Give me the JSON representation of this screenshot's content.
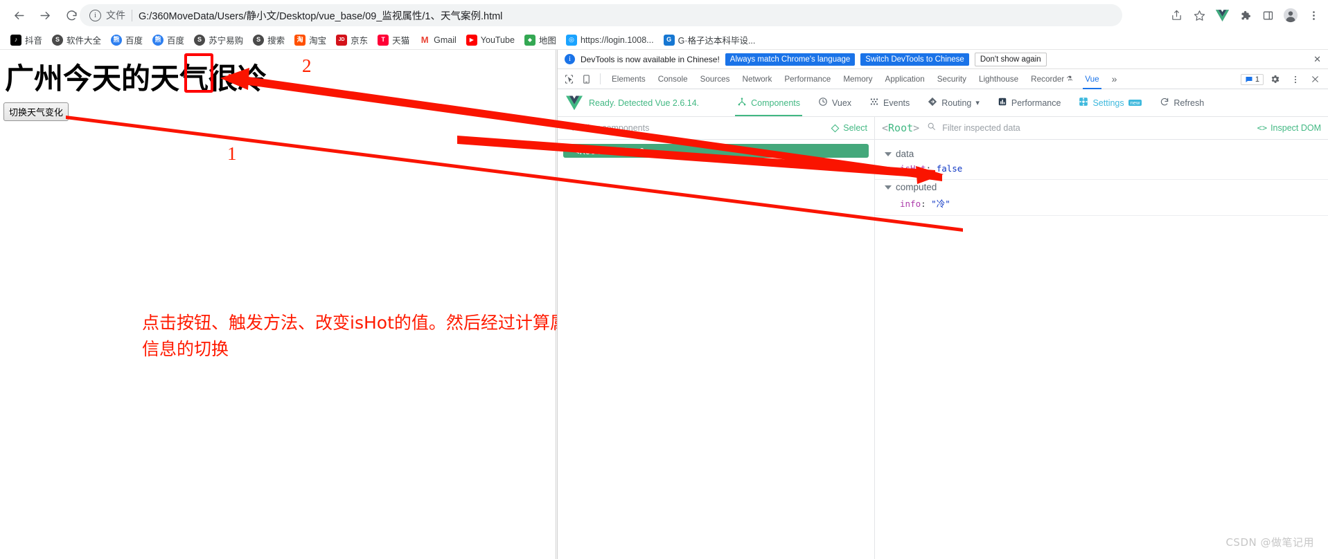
{
  "browser": {
    "nav": {
      "back": "back-arrow",
      "forward": "forward-arrow",
      "reload": "reload"
    },
    "omnibox": {
      "info_icon": "info-circle-icon",
      "scheme_label": "文件",
      "url": "G:/360MoveData/Users/静小文/Desktop/vue_base/09_监视属性/1、天气案例.html"
    },
    "toolbar_icons": [
      "share-icon",
      "bookmark-star-icon",
      "vue-devtools-icon",
      "extensions-puzzle-icon",
      "side-panel-icon",
      "profile-avatar-icon",
      "chrome-menu-icon"
    ],
    "bookmarks": [
      {
        "label": "抖音",
        "color": "#000000",
        "glyph": "♪"
      },
      {
        "label": "软件大全",
        "color": "#3d3d3d",
        "glyph": "S"
      },
      {
        "label": "百度",
        "color": "#2d7ff0",
        "glyph": "熊"
      },
      {
        "label": "百度",
        "color": "#2d7ff0",
        "glyph": "熊"
      },
      {
        "label": "苏宁易购",
        "color": "#3d3d3d",
        "glyph": "S"
      },
      {
        "label": "搜索",
        "color": "#3d3d3d",
        "glyph": "S"
      },
      {
        "label": "淘宝",
        "color": "#ff5000",
        "glyph": "淘"
      },
      {
        "label": "京东",
        "color": "#d3121a",
        "glyph": "JD"
      },
      {
        "label": "天猫",
        "color": "#ff0036",
        "glyph": "T"
      },
      {
        "label": "Gmail",
        "color": "#ea4335",
        "glyph": "M"
      },
      {
        "label": "YouTube",
        "color": "#ff0000",
        "glyph": "▶"
      },
      {
        "label": "地图",
        "color": "#34a853",
        "glyph": "📍"
      },
      {
        "label": "https://login.1008...",
        "color": "#1aa3ff",
        "glyph": "◎"
      },
      {
        "label": "G·格子达本科毕设...",
        "color": "#1677d2",
        "glyph": "G"
      }
    ]
  },
  "page": {
    "heading_prefix": "广州今天的天气很",
    "heading_highlight": "冷",
    "button_label": "切换天气变化",
    "annotation_line1": "点击按钮、触发方法、改变isHot的值。然后经过计算属性的计算。使用三元运算符、进行展示",
    "annotation_line2": "信息的切换",
    "marker_1": "1",
    "marker_2": "2"
  },
  "devtools": {
    "notice": {
      "info_icon": "info-icon",
      "message": "DevTools is now available in Chinese!",
      "btn_always": "Always match Chrome's language",
      "btn_switch": "Switch DevTools to Chinese",
      "btn_dismiss": "Don't show again",
      "close_icon": "close-icon"
    },
    "tools": [
      "inspect-element-icon",
      "device-toolbar-icon"
    ],
    "tabs": [
      {
        "label": "Elements",
        "active": false
      },
      {
        "label": "Console",
        "active": false
      },
      {
        "label": "Sources",
        "active": false
      },
      {
        "label": "Network",
        "active": false
      },
      {
        "label": "Performance",
        "active": false
      },
      {
        "label": "Memory",
        "active": false
      },
      {
        "label": "Application",
        "active": false
      },
      {
        "label": "Security",
        "active": false
      },
      {
        "label": "Lighthouse",
        "active": false
      },
      {
        "label": "Recorder",
        "active": false,
        "suffix_icon": "flask-icon"
      },
      {
        "label": "Vue",
        "active": true
      }
    ],
    "tabs_overflow": "»",
    "right": {
      "messages_icon": "message-badge-icon",
      "messages_count": "1",
      "settings_icon": "gear-icon",
      "more_icon": "more-vertical-icon",
      "close_icon": "close-icon"
    },
    "vue": {
      "logo": "vue-logo-icon",
      "status": "Ready. Detected Vue 2.6.14.",
      "actions": [
        {
          "label": "Components",
          "icon": "components-icon",
          "active": true
        },
        {
          "label": "Vuex",
          "icon": "vuex-clock-icon",
          "active": false
        },
        {
          "label": "Events",
          "icon": "events-icon",
          "active": false
        },
        {
          "label": "Routing",
          "icon": "routing-icon",
          "active": false,
          "caret": "▾"
        },
        {
          "label": "Performance",
          "icon": "performance-bars-icon",
          "active": false
        },
        {
          "label": "Settings",
          "icon": "settings-gear-icon",
          "active": false,
          "badge": "new"
        },
        {
          "label": "Refresh",
          "icon": "refresh-icon",
          "active": false
        }
      ],
      "components_pane": {
        "search_icon": "search-icon",
        "filter_placeholder": "Filter components",
        "select_icon": "select-target-icon",
        "select_label": "Select",
        "tree": [
          {
            "label": "<Root> = $vm0",
            "selected": true
          }
        ]
      },
      "inspector_pane": {
        "root_label": "<Root>",
        "search_icon": "search-icon",
        "filter_placeholder": "Filter inspected data",
        "inspect_dom_icon": "code-brackets-icon",
        "inspect_dom_label": "Inspect DOM",
        "groups": [
          {
            "name": "data",
            "entries": [
              {
                "key": "isHot",
                "value": "false",
                "kind": "bool"
              }
            ]
          },
          {
            "name": "computed",
            "entries": [
              {
                "key": "info",
                "value": "\"冷\"",
                "kind": "string"
              }
            ]
          }
        ]
      }
    }
  },
  "watermark": "CSDN @做笔记用",
  "colors": {
    "accent_blue": "#1a73e8",
    "vue_green": "#42b883",
    "annotation_red": "#ff1a00",
    "tree_selected": "#44a87b"
  }
}
